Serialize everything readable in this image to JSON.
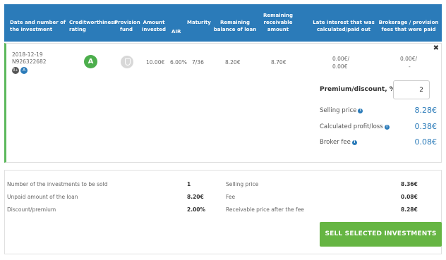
{
  "header": {
    "col_date": "Date and number of the investment",
    "col_rating": "Creditworthiness rating",
    "col_provision": "Provision fund",
    "col_amount": "Amount invested",
    "col_air": "AIR",
    "col_maturity": "Maturity",
    "col_remaining_balance": "Remaining balance of loan",
    "col_remaining_receivable": "Remaining receivable amount",
    "col_late_interest": "Late interest that was calculated/paid out",
    "col_brokerage": "Brokerage / provision fees that were paid"
  },
  "investment": {
    "date": "2018-12-19",
    "number": "N926322682",
    "badge_rp": "R+",
    "badge_a": "A",
    "rating": "A",
    "amount_invested": "10.00€",
    "air": "6.00%",
    "maturity": "7/36",
    "remaining_balance": "8.20€",
    "remaining_receivable": "8.70€",
    "late_interest_calc": "0.00€/",
    "late_interest_paid": "0.00€",
    "brokerage_paid": "0.00€/",
    "brokerage_dash": "-",
    "close_symbol": "✖",
    "premium_label": "Premium/discount, %",
    "premium_value": "2",
    "selling_price_label": "Selling price",
    "selling_price_value": "8.28€",
    "profit_label": "Calculated profit/loss",
    "profit_value": "0.38€",
    "broker_fee_label": "Broker fee",
    "broker_fee_value": "0.08€",
    "info_symbol": "i"
  },
  "summary": {
    "num_label": "Number of the investments to be sold",
    "num_value": "1",
    "unpaid_label": "Unpaid amount of the loan",
    "unpaid_value": "8.20€",
    "discount_label": "Discount/premium",
    "discount_value": "2.00%",
    "selling_price_label": "Selling price",
    "selling_price_value": "8.36€",
    "fee_label": "Fee",
    "fee_value": "0.08€",
    "receivable_label": "Receivable price after the fee",
    "receivable_value": "8.28€",
    "sell_button": "SELL SELECTED INVESTMENTS"
  },
  "colors": {
    "header_bg": "#2b7bb9",
    "accent_green": "#5cb85c",
    "button_green": "#66b543",
    "value_blue": "#2b7bb9"
  }
}
